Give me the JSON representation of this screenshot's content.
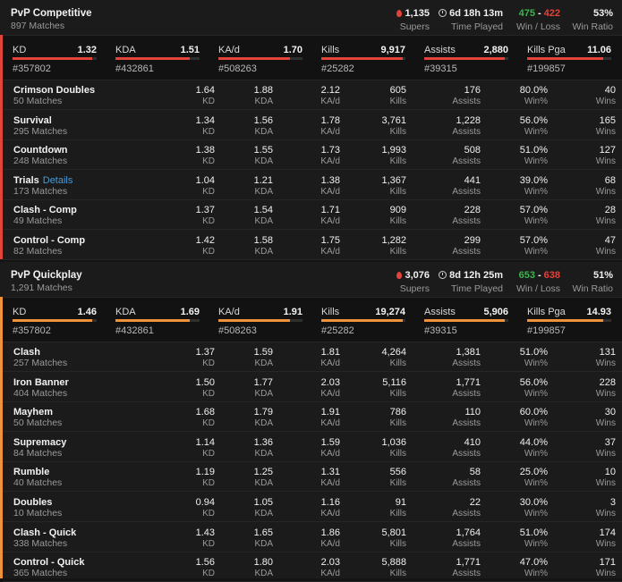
{
  "colors": {
    "competitive": "#e2433a",
    "quickplay": "#f0923a",
    "win": "#3fb34f",
    "loss": "#e2433a"
  },
  "competitive": {
    "title": "PvP Competitive",
    "matches": "897 Matches",
    "supers": "1,135",
    "supers_label": "Supers",
    "time": "6d 18h 13m",
    "time_label": "Time Played",
    "wins": "475",
    "sep": "-",
    "losses": "422",
    "wl_label": "Win / Loss",
    "ratio": "53%",
    "ratio_label": "Win Ratio",
    "overview": [
      {
        "label": "KD",
        "value": "1.32",
        "rank": "#357802",
        "fill": 0.95
      },
      {
        "label": "KDA",
        "value": "1.51",
        "rank": "#432861",
        "fill": 0.88
      },
      {
        "label": "KA/d",
        "value": "1.70",
        "rank": "#508263",
        "fill": 0.85
      },
      {
        "label": "Kills",
        "value": "9,917",
        "rank": "#25282",
        "fill": 0.97
      },
      {
        "label": "Assists",
        "value": "2,880",
        "rank": "#39315",
        "fill": 0.96
      },
      {
        "label": "Kills Pga",
        "value": "11.06",
        "rank": "#199857",
        "fill": 0.9
      }
    ],
    "modes": [
      {
        "name": "Crimson Doubles",
        "link": "",
        "matches": "50 Matches",
        "kd": "1.64",
        "kda": "1.88",
        "kad": "2.12",
        "kills": "605",
        "assists": "176",
        "win": "80.0%",
        "wins": "40"
      },
      {
        "name": "Survival",
        "link": "",
        "matches": "295 Matches",
        "kd": "1.34",
        "kda": "1.56",
        "kad": "1.78",
        "kills": "3,761",
        "assists": "1,228",
        "win": "56.0%",
        "wins": "165"
      },
      {
        "name": "Countdown",
        "link": "",
        "matches": "248 Matches",
        "kd": "1.38",
        "kda": "1.55",
        "kad": "1.73",
        "kills": "1,993",
        "assists": "508",
        "win": "51.0%",
        "wins": "127"
      },
      {
        "name": "Trials",
        "link": "Details",
        "matches": "173 Matches",
        "kd": "1.04",
        "kda": "1.21",
        "kad": "1.38",
        "kills": "1,367",
        "assists": "441",
        "win": "39.0%",
        "wins": "68"
      },
      {
        "name": "Clash - Comp",
        "link": "",
        "matches": "49 Matches",
        "kd": "1.37",
        "kda": "1.54",
        "kad": "1.71",
        "kills": "909",
        "assists": "228",
        "win": "57.0%",
        "wins": "28"
      },
      {
        "name": "Control - Comp",
        "link": "",
        "matches": "82 Matches",
        "kd": "1.42",
        "kda": "1.58",
        "kad": "1.75",
        "kills": "1,282",
        "assists": "299",
        "win": "57.0%",
        "wins": "47"
      }
    ]
  },
  "quickplay": {
    "title": "PvP Quickplay",
    "matches": "1,291 Matches",
    "supers": "3,076",
    "supers_label": "Supers",
    "time": "8d 12h 25m",
    "time_label": "Time Played",
    "wins": "653",
    "sep": "-",
    "losses": "638",
    "wl_label": "Win / Loss",
    "ratio": "51%",
    "ratio_label": "Win Ratio",
    "overview": [
      {
        "label": "KD",
        "value": "1.46",
        "rank": "#357802",
        "fill": 0.95
      },
      {
        "label": "KDA",
        "value": "1.69",
        "rank": "#432861",
        "fill": 0.88
      },
      {
        "label": "KA/d",
        "value": "1.91",
        "rank": "#508263",
        "fill": 0.85
      },
      {
        "label": "Kills",
        "value": "19,274",
        "rank": "#25282",
        "fill": 0.97
      },
      {
        "label": "Assists",
        "value": "5,906",
        "rank": "#39315",
        "fill": 0.96
      },
      {
        "label": "Kills Pga",
        "value": "14.93",
        "rank": "#199857",
        "fill": 0.9
      }
    ],
    "modes": [
      {
        "name": "Clash",
        "link": "",
        "matches": "257 Matches",
        "kd": "1.37",
        "kda": "1.59",
        "kad": "1.81",
        "kills": "4,264",
        "assists": "1,381",
        "win": "51.0%",
        "wins": "131"
      },
      {
        "name": "Iron Banner",
        "link": "",
        "matches": "404 Matches",
        "kd": "1.50",
        "kda": "1.77",
        "kad": "2.03",
        "kills": "5,116",
        "assists": "1,771",
        "win": "56.0%",
        "wins": "228"
      },
      {
        "name": "Mayhem",
        "link": "",
        "matches": "50 Matches",
        "kd": "1.68",
        "kda": "1.79",
        "kad": "1.91",
        "kills": "786",
        "assists": "110",
        "win": "60.0%",
        "wins": "30"
      },
      {
        "name": "Supremacy",
        "link": "",
        "matches": "84 Matches",
        "kd": "1.14",
        "kda": "1.36",
        "kad": "1.59",
        "kills": "1,036",
        "assists": "410",
        "win": "44.0%",
        "wins": "37"
      },
      {
        "name": "Rumble",
        "link": "",
        "matches": "40 Matches",
        "kd": "1.19",
        "kda": "1.25",
        "kad": "1.31",
        "kills": "556",
        "assists": "58",
        "win": "25.0%",
        "wins": "10"
      },
      {
        "name": "Doubles",
        "link": "",
        "matches": "10 Matches",
        "kd": "0.94",
        "kda": "1.05",
        "kad": "1.16",
        "kills": "91",
        "assists": "22",
        "win": "30.0%",
        "wins": "3"
      },
      {
        "name": "Clash - Quick",
        "link": "",
        "matches": "338 Matches",
        "kd": "1.43",
        "kda": "1.65",
        "kad": "1.86",
        "kills": "5,801",
        "assists": "1,764",
        "win": "51.0%",
        "wins": "174"
      },
      {
        "name": "Control - Quick",
        "link": "",
        "matches": "365 Matches",
        "kd": "1.56",
        "kda": "1.80",
        "kad": "2.03",
        "kills": "5,888",
        "assists": "1,771",
        "win": "47.0%",
        "wins": "171"
      }
    ]
  },
  "col_labels": {
    "kd": "KD",
    "kda": "KDA",
    "kad": "KA/d",
    "kills": "Kills",
    "assists": "Assists",
    "win": "Win%",
    "wins": "Wins"
  }
}
